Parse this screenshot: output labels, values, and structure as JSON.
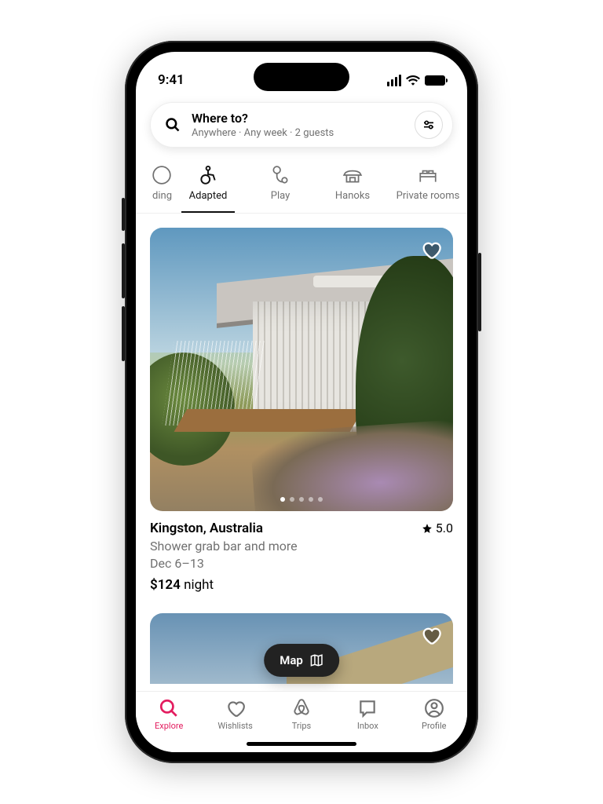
{
  "status": {
    "time": "9:41"
  },
  "search": {
    "title": "Where to?",
    "subtitle": "Anywhere · Any week · 2 guests"
  },
  "tabs": {
    "partial": "ding",
    "items": [
      {
        "label": "Adapted"
      },
      {
        "label": "Play"
      },
      {
        "label": "Hanoks"
      },
      {
        "label": "Private rooms"
      }
    ]
  },
  "listing": {
    "location": "Kingston, Australia",
    "rating": "5.0",
    "feature": "Shower grab bar and more",
    "dates": "Dec 6–13",
    "price_amount": "$124",
    "price_unit": " night"
  },
  "map_button": "Map",
  "nav": {
    "explore": "Explore",
    "wishlists": "Wishlists",
    "trips": "Trips",
    "inbox": "Inbox",
    "profile": "Profile"
  }
}
